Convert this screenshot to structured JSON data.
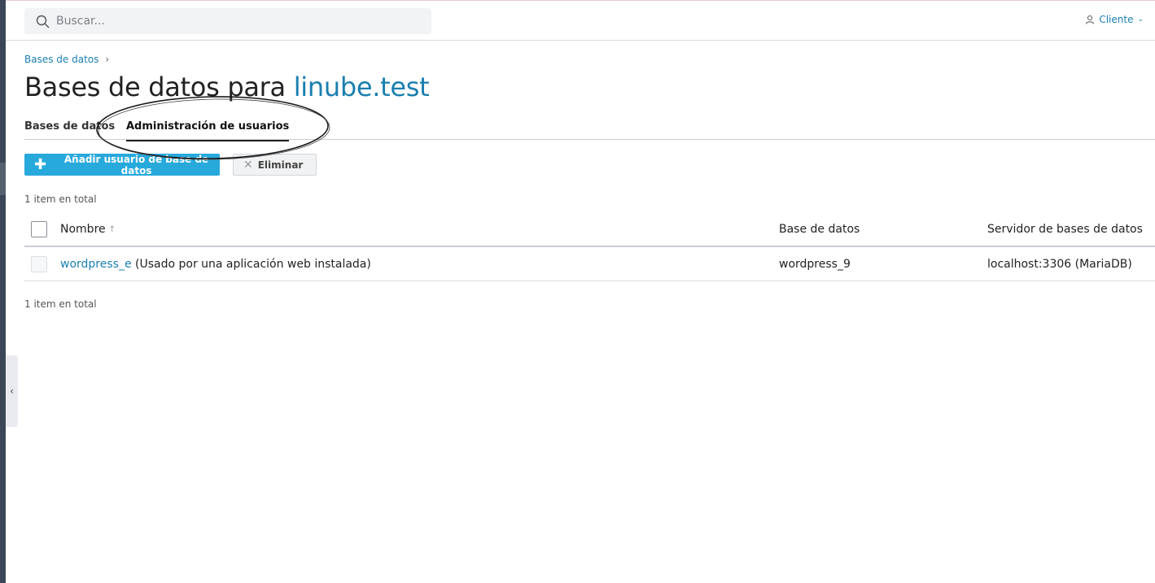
{
  "header": {
    "search_placeholder": "Buscar...",
    "user_label": "Cliente"
  },
  "breadcrumb": {
    "item": "Bases de datos"
  },
  "title": {
    "prefix": "Bases de datos para ",
    "domain": "linube.test"
  },
  "tabs": [
    {
      "label": "Bases de datos",
      "active": false
    },
    {
      "label": "Administración de usuarios",
      "active": true
    }
  ],
  "toolbar": {
    "add_label": "Añadir usuario de base de datos",
    "delete_label": "Eliminar"
  },
  "summary": {
    "top": "1 item en total",
    "bottom": "1 item en total"
  },
  "table": {
    "columns": {
      "name": "Nombre",
      "database": "Base de datos",
      "server": "Servidor de bases de datos"
    },
    "rows": [
      {
        "name": "wordpress_e",
        "note": " (Usado por una aplicación web instalada)",
        "database": "wordpress_9",
        "server": "localhost:3306 (MariaDB)"
      }
    ]
  },
  "colors": {
    "accent": "#1a7fb0",
    "primary_button": "#28a9dc",
    "sidebar": "#3b4656"
  }
}
